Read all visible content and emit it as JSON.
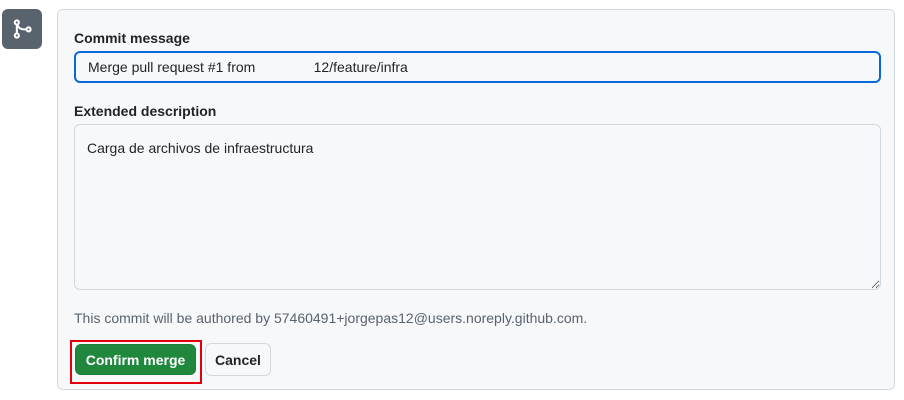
{
  "merge_icon": {
    "icon": "git-merge-icon",
    "bg_color": "#59636e"
  },
  "form": {
    "commit_message_label": "Commit message",
    "commit_message_value": "Merge pull request #1 from               12/feature/infra",
    "extended_description_label": "Extended description",
    "extended_description_value": "Carga de archivos de infraestructura",
    "author_note": "This commit will be authored by 57460491+jorgepas12@users.noreply.github.com."
  },
  "actions": {
    "confirm_label": "Confirm merge",
    "cancel_label": "Cancel",
    "confirm_color": "#1f883d",
    "highlight_color": "#e0000e"
  }
}
